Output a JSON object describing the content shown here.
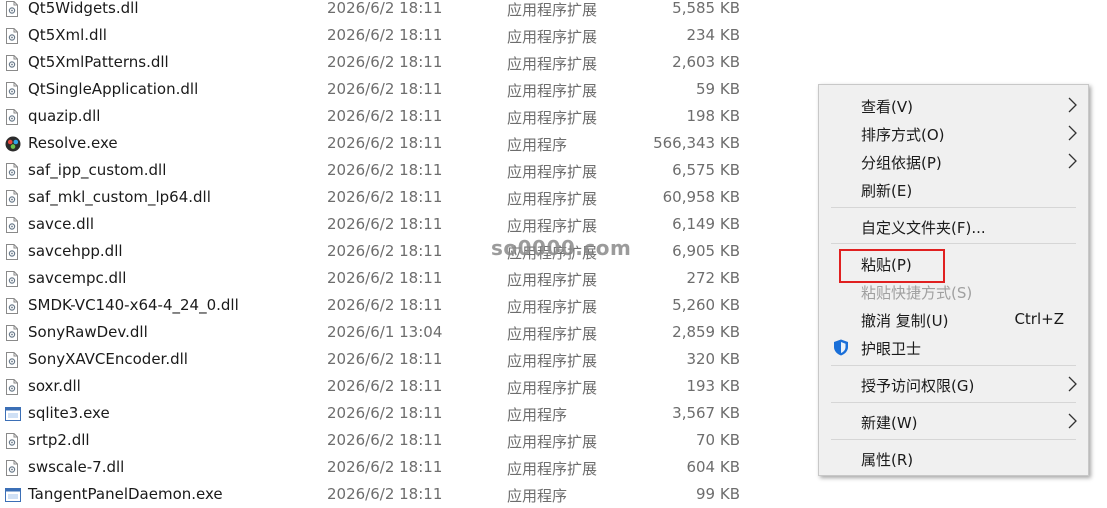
{
  "files": [
    {
      "name": "Qt5Widgets.dll",
      "date": "2026/6/2 18:11",
      "type": "应用程序扩展",
      "size": "5,585 KB",
      "icon": "dll-icon"
    },
    {
      "name": "Qt5Xml.dll",
      "date": "2026/6/2 18:11",
      "type": "应用程序扩展",
      "size": "234 KB",
      "icon": "dll-icon"
    },
    {
      "name": "Qt5XmlPatterns.dll",
      "date": "2026/6/2 18:11",
      "type": "应用程序扩展",
      "size": "2,603 KB",
      "icon": "dll-icon"
    },
    {
      "name": "QtSingleApplication.dll",
      "date": "2026/6/2 18:11",
      "type": "应用程序扩展",
      "size": "59 KB",
      "icon": "dll-icon"
    },
    {
      "name": "quazip.dll",
      "date": "2026/6/2 18:11",
      "type": "应用程序扩展",
      "size": "198 KB",
      "icon": "dll-icon"
    },
    {
      "name": "Resolve.exe",
      "date": "2026/6/2 18:11",
      "type": "应用程序",
      "size": "566,343 KB",
      "icon": "resolve-app-icon"
    },
    {
      "name": "saf_ipp_custom.dll",
      "date": "2026/6/2 18:11",
      "type": "应用程序扩展",
      "size": "6,575 KB",
      "icon": "dll-icon"
    },
    {
      "name": "saf_mkl_custom_lp64.dll",
      "date": "2026/6/2 18:11",
      "type": "应用程序扩展",
      "size": "60,958 KB",
      "icon": "dll-icon"
    },
    {
      "name": "savce.dll",
      "date": "2026/6/2 18:11",
      "type": "应用程序扩展",
      "size": "6,149 KB",
      "icon": "dll-icon"
    },
    {
      "name": "savcehpp.dll",
      "date": "2026/6/2 18:11",
      "type": "应用程序扩展",
      "size": "6,905 KB",
      "icon": "dll-icon"
    },
    {
      "name": "savcempc.dll",
      "date": "2026/6/2 18:11",
      "type": "应用程序扩展",
      "size": "272 KB",
      "icon": "dll-icon"
    },
    {
      "name": "SMDK-VC140-x64-4_24_0.dll",
      "date": "2026/6/2 18:11",
      "type": "应用程序扩展",
      "size": "5,260 KB",
      "icon": "dll-icon"
    },
    {
      "name": "SonyRawDev.dll",
      "date": "2026/6/1 13:04",
      "type": "应用程序扩展",
      "size": "2,859 KB",
      "icon": "dll-icon"
    },
    {
      "name": "SonyXAVCEncoder.dll",
      "date": "2026/6/2 18:11",
      "type": "应用程序扩展",
      "size": "320 KB",
      "icon": "dll-icon"
    },
    {
      "name": "soxr.dll",
      "date": "2026/6/2 18:11",
      "type": "应用程序扩展",
      "size": "193 KB",
      "icon": "dll-icon"
    },
    {
      "name": "sqlite3.exe",
      "date": "2026/6/2 18:11",
      "type": "应用程序",
      "size": "3,567 KB",
      "icon": "exe-window-icon"
    },
    {
      "name": "srtp2.dll",
      "date": "2026/6/2 18:11",
      "type": "应用程序扩展",
      "size": "70 KB",
      "icon": "dll-icon"
    },
    {
      "name": "swscale-7.dll",
      "date": "2026/6/2 18:11",
      "type": "应用程序扩展",
      "size": "604 KB",
      "icon": "dll-icon"
    },
    {
      "name": "TangentPanelDaemon.exe",
      "date": "2026/6/2 18:11",
      "type": "应用程序",
      "size": "99 KB",
      "icon": "exe-window-icon"
    }
  ],
  "watermark": "so0000.com",
  "context_menu": {
    "items": [
      {
        "label": "查看(V)",
        "submenu": true
      },
      {
        "label": "排序方式(O)",
        "submenu": true
      },
      {
        "label": "分组依据(P)",
        "submenu": true
      },
      {
        "label": "刷新(E)"
      },
      {
        "label": "自定义文件夹(F)..."
      },
      {
        "label": "粘贴(P)",
        "highlighted": true
      },
      {
        "label": "粘贴快捷方式(S)",
        "disabled": true
      },
      {
        "label": "撤消 复制(U)",
        "shortcut": "Ctrl+Z"
      },
      {
        "label": "护眼卫士",
        "icon": "shield-icon"
      },
      {
        "label": "授予访问权限(G)",
        "submenu": true
      },
      {
        "label": "新建(W)",
        "submenu": true
      },
      {
        "label": "属性(R)"
      }
    ]
  },
  "colors": {
    "highlight_border": "#e02020",
    "menu_bg": "#f0f0f0",
    "shield_blue": "#1a6fd8"
  }
}
